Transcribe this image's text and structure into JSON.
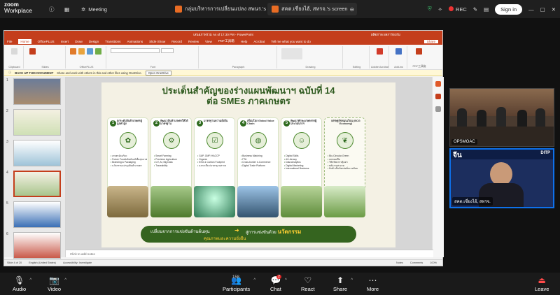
{
  "zoom": {
    "app_line1": "zoom",
    "app_line2": "Workplace",
    "tabs": [
      {
        "label": "Meeting"
      },
      {
        "label": "กลุ่มบริหารการเปลี่ยนแปลง สพนร.'s screen"
      },
      {
        "label": "สคต.เซี่ยงไฮ้, สทรจ.'s screen"
      }
    ],
    "rec_label": "REC",
    "signin_label": "Sign in"
  },
  "powerpoint": {
    "title": "เสนอภาพรวม As of 17.30 PM - PowerPoint",
    "user": "ผลิตภาพ ผลการอบรม",
    "menu": [
      "File",
      "Home",
      "OfficePLUS",
      "Insert",
      "Draw",
      "Design",
      "Transitions",
      "Animations",
      "Slide Show",
      "Record",
      "Review",
      "View",
      "PDF工具箱",
      "Help",
      "Acrobat",
      "Tell me what you want to do"
    ],
    "share_label": "Share",
    "ribbon_groups": [
      "Clipboard",
      "Slides",
      "OfficePLUS",
      "Font",
      "Paragraph",
      "Drawing",
      "Editing",
      "Adobe Acrobat",
      "Add-ins",
      "PDF工具箱"
    ],
    "message": {
      "bold": "BACK UP THIS DOCUMENT",
      "text": "Share and work with others in this and other files using OneDrive.",
      "button": "Open OneDrive"
    },
    "thumb_numbers": [
      "1",
      "2",
      "3",
      "4",
      "5",
      "6"
    ],
    "notes_placeholder": "Click to add notes",
    "status": {
      "slide": "Slide 4 of 20",
      "language": "English (United States)",
      "accessibility": "Accessibility: Investigate",
      "notes": "Notes",
      "comments": "Comments",
      "zoom": "100%"
    }
  },
  "slide": {
    "title_line1": "ประเด็นสำคัญของร่างแผนพัฒนาฯ ฉบับที่ 14",
    "title_line2": "ต่อ SMEs ภาคเกษตร",
    "cards": [
      {
        "num": "1",
        "title": "ยกระดับสินค้าเกษตรสู่มูลค่าสูง",
        "icon": "sprout-icon",
        "glyph": "✿",
        "items": [
          "เกษตรอัจฉริยะ",
          "Future Food/ผลิตภัณฑ์เพื่อสุขภาพ",
          "Branding & Packaging",
          "นวัตกรรมแปรรูปสินค้าเกษตร"
        ]
      },
      {
        "num": "2",
        "title": "พัฒนาสินค้าเกษตรให้ได้มาตรฐาน",
        "icon": "tractor-icon",
        "glyph": "⚙",
        "items": [
          "Smart Farming",
          "Precision Agriculture",
          "IoT, AI, Big Data",
          "Traceability"
        ]
      },
      {
        "num": "3",
        "title": "มาตรฐานความยั่งยืน",
        "icon": "checklist-icon",
        "glyph": "☑",
        "items": [
          "GAP, GMP, HACCP",
          "Organic",
          "ESG & Carbon Footprint",
          "ฉลากเขียว/มาตรฐานสากล"
        ]
      },
      {
        "num": "4",
        "title": "เชื่อมโยง Global Value Chain",
        "icon": "globe-icon",
        "glyph": "◍",
        "items": [
          "Business Matching",
          "FTA",
          "Cross-border e-Commerce",
          "Digital Trade Platform"
        ]
      },
      {
        "num": "5",
        "title": "พัฒนาทักษะเกษตรกรผู้ประกอบการ",
        "icon": "people-icon",
        "glyph": "☺",
        "items": [
          "Digital Skills",
          "AI Literacy",
          "Data Analytics",
          "Digital Marketing",
          "International Business"
        ]
      },
      {
        "num": "",
        "title": "เศรษฐกิจหมุนเวียน (BCG Economy)",
        "icon": "leaf-icon",
        "glyph": "❦",
        "items": [
          "Bio-Circular-Green",
          "ลดของเสีย",
          "ใช้ทรัพยากรคุ้มค่า",
          "พลังงานสะอาด",
          "สินค้าเป็นมิตรต่อสิ่งแวดล้อม"
        ]
      }
    ],
    "banner_line1": "เปลี่ยนจากการแข่งขันด้านต้นทุน",
    "banner_arrow": "➜",
    "banner_line2_prefix": "สู่การแข่งขันด้วย",
    "banner_highlight": "นวัตกรรม",
    "banner_line3": "คุณภาพและความยั่งยืน"
  },
  "videos": [
    {
      "name": "OPSMOAC"
    },
    {
      "name": "สคต.เซี่ยงไฮ้, สทรจ.",
      "overlay": "จีน",
      "logo": "DITP"
    }
  ],
  "toolbar": [
    {
      "label": "Audio",
      "icon": "mic-muted-icon",
      "glyph": "🎙"
    },
    {
      "label": "Video",
      "icon": "camera-off-icon",
      "glyph": "📷"
    },
    {
      "label": "Participants",
      "icon": "participants-icon",
      "glyph": "👥",
      "count": "158"
    },
    {
      "label": "Chat",
      "icon": "chat-icon",
      "glyph": "💬",
      "badge": "2"
    },
    {
      "label": "React",
      "icon": "heart-icon",
      "glyph": "♡"
    },
    {
      "label": "Share",
      "icon": "share-screen-icon",
      "glyph": "⬆"
    },
    {
      "label": "More",
      "icon": "more-icon",
      "glyph": "⋯"
    },
    {
      "label": "Leave",
      "icon": "leave-icon",
      "glyph": "⏏"
    }
  ]
}
